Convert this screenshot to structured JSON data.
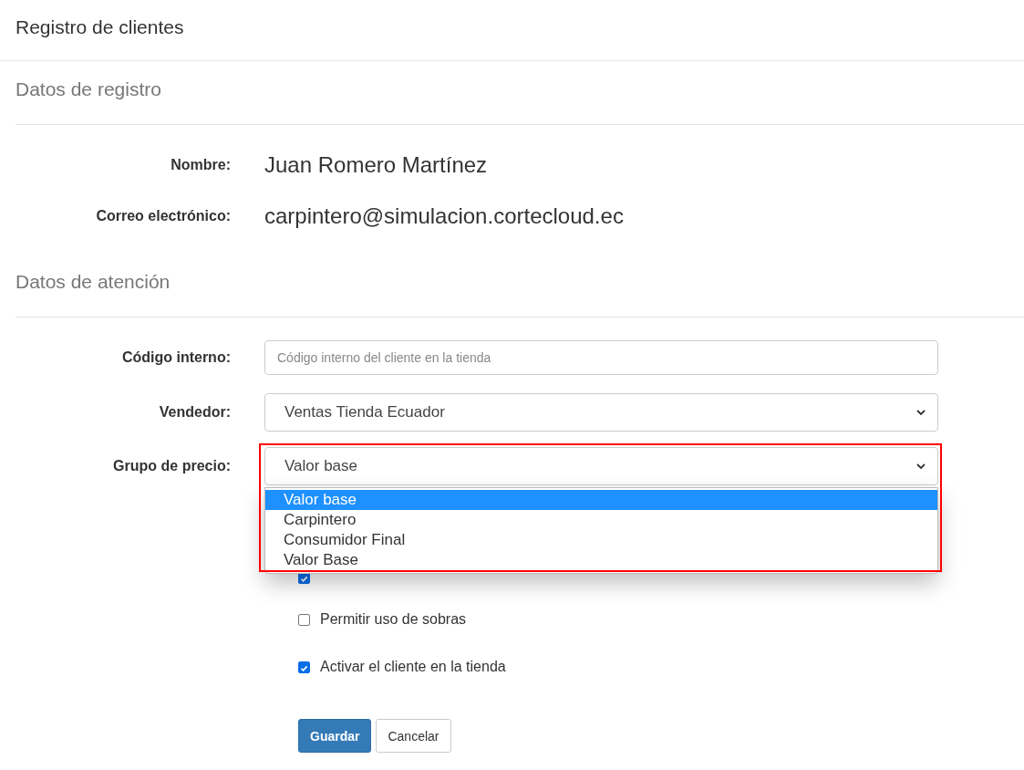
{
  "header": {
    "title": "Registro de clientes"
  },
  "sections": [
    {
      "title": "Datos de registro",
      "fields": [
        {
          "kind": "static",
          "label": "Nombre:",
          "value": "Juan Romero Martínez"
        },
        {
          "kind": "static",
          "label": "Correo electrónico:",
          "value": "carpintero@simulacion.cortecloud.ec"
        }
      ]
    },
    {
      "title": "Datos de atención",
      "fields": [
        {
          "kind": "input",
          "label": "Código interno:",
          "placeholder": "Código interno del cliente en la tienda"
        },
        {
          "kind": "select",
          "label": "Vendedor:",
          "value": "Ventas Tienda Ecuador"
        },
        {
          "kind": "select",
          "label": "Grupo de precio:",
          "value": "Valor base",
          "highlighted": true,
          "expanded": true,
          "options": [
            {
              "label": "Valor base",
              "selected": true
            },
            {
              "label": "Carpintero",
              "selected": false
            },
            {
              "label": "Consumidor Final",
              "selected": false
            },
            {
              "label": "Valor Base",
              "selected": false
            }
          ]
        }
      ]
    }
  ],
  "checkboxes": [
    {
      "checked": true
    },
    {
      "label": "Permitir uso de sobras",
      "checked": false
    },
    {
      "label": "Activar el cliente en la tienda",
      "checked": true
    }
  ],
  "buttons": [
    {
      "label": "Guardar",
      "kind": "primary"
    },
    {
      "label": "Cancelar",
      "kind": "default"
    }
  ]
}
